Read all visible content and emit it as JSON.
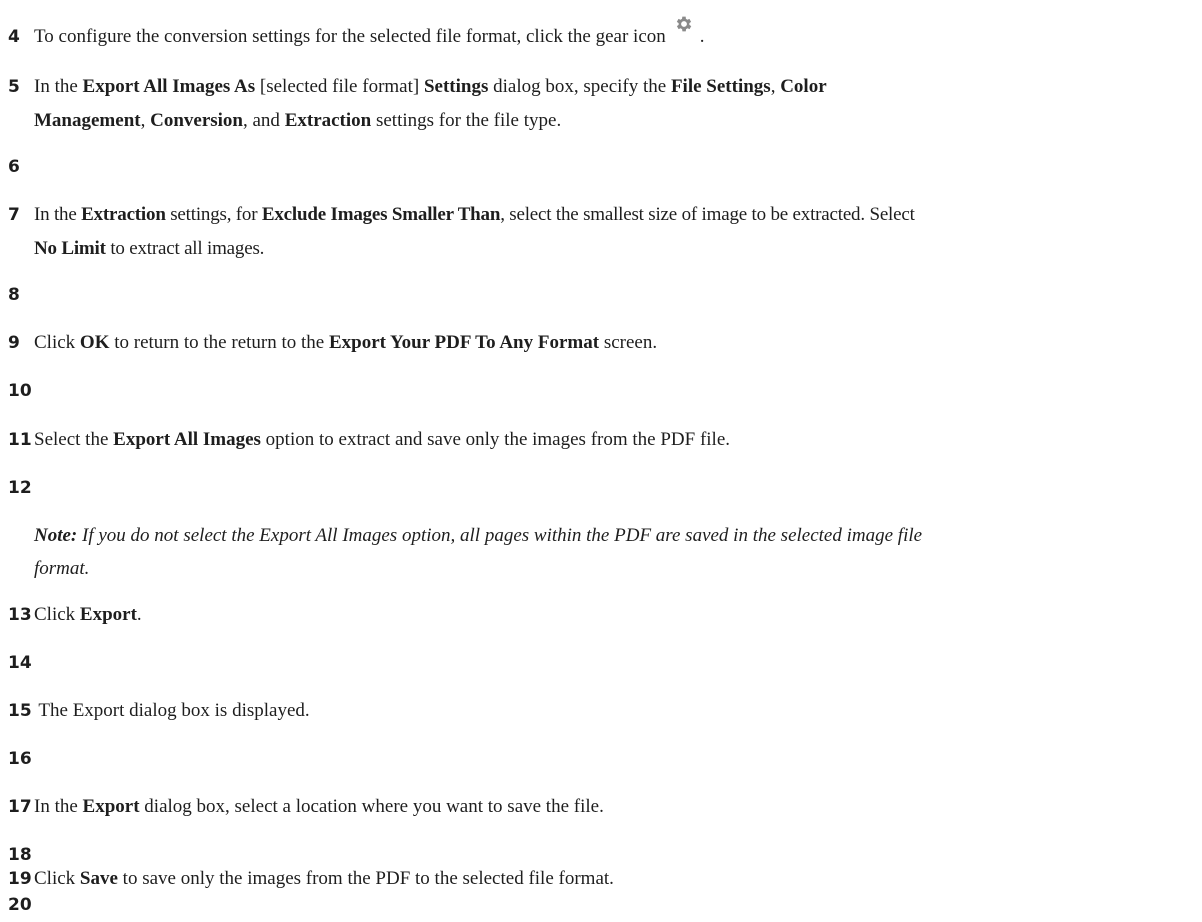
{
  "steps": [
    {
      "num": "4",
      "before": "To configure the conversion settings for the selected file format, click the gear icon",
      "after": "."
    },
    {
      "num": "5",
      "t1": "In the ",
      "b1": "Export All Images As",
      "t2": " [selected file format] ",
      "b2": "Settings",
      "t3": " dialog box, specify the ",
      "b3": "File Settings",
      "t4": ", ",
      "b4": "Color",
      "b5": "Management",
      "t5": ", ",
      "b6": "Conversion",
      "t6": ", and ",
      "b7": "Extraction",
      "t7": " settings for the file type."
    },
    {
      "num": "6"
    },
    {
      "num": "7",
      "t1": "In the ",
      "b1": "Extraction",
      "t2": " settings, for ",
      "b2": "Exclude Images Smaller Than",
      "t3": ", select the smallest size of image to be extracted. Select",
      "b3": "No Limit",
      "t4": " to extract all images."
    },
    {
      "num": "8"
    },
    {
      "num": "9",
      "t1": "Click ",
      "b1": "OK",
      "t2": " to return to the return to the ",
      "b2": "Export Your PDF To Any Format",
      "t3": " screen."
    },
    {
      "num": "10"
    },
    {
      "num": "11",
      "t1": "Select the ",
      "b1": "Export All Images",
      "t2": " option to extract and save only the images from the PDF file."
    },
    {
      "num": "12"
    },
    {
      "note_label": "Note:",
      "note_text": " If you do not select the Export All Images option, all pages within the PDF are saved in the selected image file",
      "note_text2": "format."
    },
    {
      "num": "13",
      "t1": "Click ",
      "b1": "Export",
      "t2": "."
    },
    {
      "num": "14"
    },
    {
      "num": "15",
      "t1": " The Export dialog box is displayed."
    },
    {
      "num": "16"
    },
    {
      "num": "17",
      "t1": "In the ",
      "b1": "Export",
      "t2": " dialog box, select a location where you want to save the file."
    },
    {
      "num": "18"
    },
    {
      "num": "19",
      "t1": "Click ",
      "b1": "Save",
      "t2": " to save only the images from the PDF to the selected file format."
    },
    {
      "num": "20"
    }
  ],
  "icons": {
    "gear": "gear-icon",
    "gear_color": "#8a8a8a"
  }
}
